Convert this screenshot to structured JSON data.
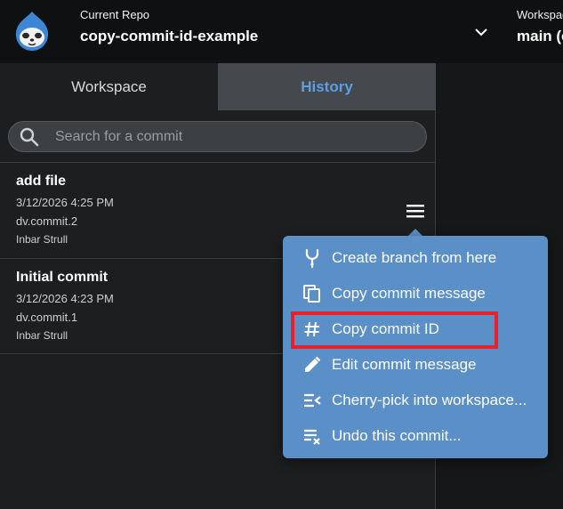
{
  "header": {
    "repo_caption": "Current Repo",
    "repo_name": "copy-commit-id-example",
    "workspace_caption": "Workspace",
    "workspace_branch": "main (c"
  },
  "tabs": [
    {
      "label": "Workspace",
      "active": false
    },
    {
      "label": "History",
      "active": true
    }
  ],
  "search": {
    "placeholder": "Search for a commit",
    "value": ""
  },
  "commits": [
    {
      "title": "add file",
      "date": "3/12/2026 4:25 PM",
      "id": "dv.commit.2",
      "author": "Inbar Strull"
    },
    {
      "title": "Initial commit",
      "date": "3/12/2026 4:23 PM",
      "id": "dv.commit.1",
      "author": "Inbar Strull"
    }
  ],
  "context_menu": {
    "items": [
      {
        "label": "Create branch from here",
        "icon": "branch-icon"
      },
      {
        "label": "Copy commit message",
        "icon": "copy-icon"
      },
      {
        "label": "Copy commit ID",
        "icon": "hash-icon",
        "highlighted": true
      },
      {
        "label": "Edit commit message",
        "icon": "pencil-icon"
      },
      {
        "label": "Cherry-pick into workspace...",
        "icon": "cherry-pick-icon"
      },
      {
        "label": "Undo this commit...",
        "icon": "undo-commit-icon"
      }
    ]
  },
  "colors": {
    "accent": "#5aa0e6",
    "menu_bg": "#5a8fc8",
    "highlight": "#e8202a",
    "topbar_bg": "#0f1011"
  }
}
